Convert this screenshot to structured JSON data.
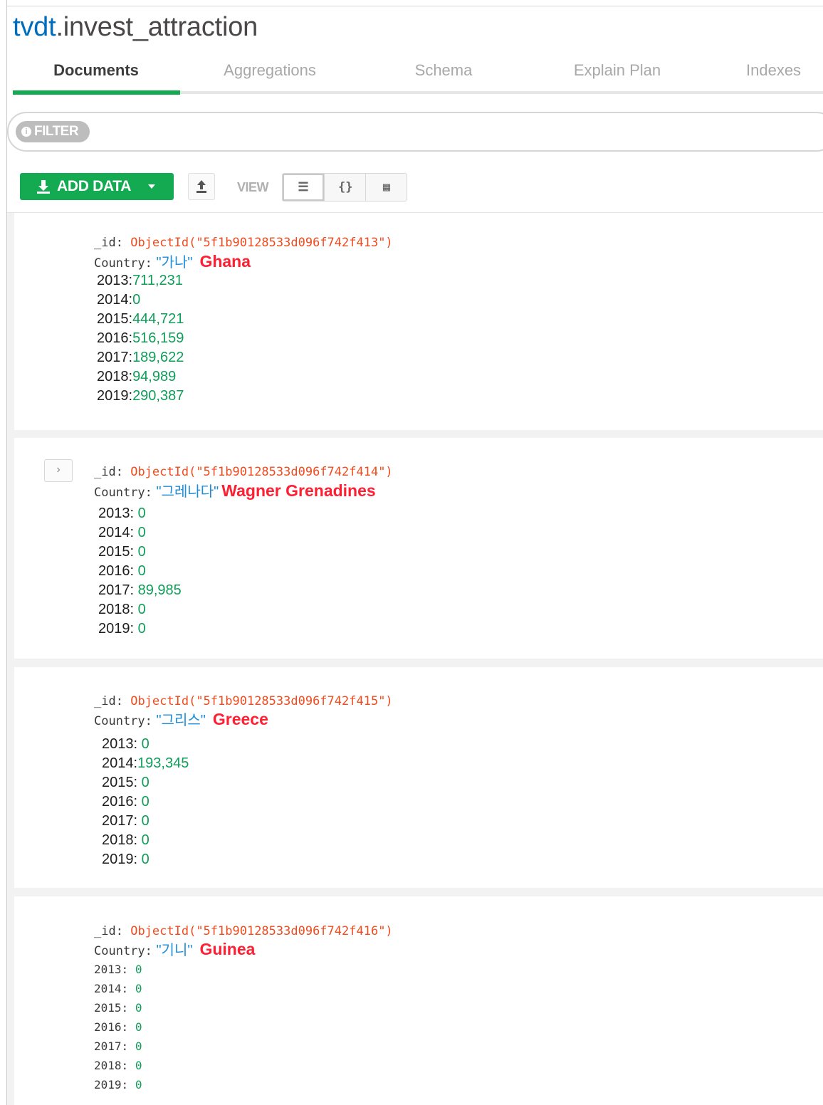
{
  "header": {
    "db": "tvdt",
    "collection": ".invest_attraction"
  },
  "tabs": [
    {
      "label": "Documents",
      "active": true
    },
    {
      "label": "Aggregations",
      "active": false
    },
    {
      "label": "Schema",
      "active": false
    },
    {
      "label": "Explain Plan",
      "active": false
    },
    {
      "label": "Indexes",
      "active": false
    }
  ],
  "filter": {
    "label": "FILTER",
    "icon": "info-icon"
  },
  "toolbar": {
    "add_data_label": "ADD DATA",
    "view_label": "VIEW",
    "views": [
      "list-view-icon",
      "json-view-icon",
      "table-view-icon"
    ],
    "active_view": "list"
  },
  "colors": {
    "accent": "#13aa52",
    "db": "#006cbc",
    "oid": "#f04b1e",
    "string": "#1e8ed8",
    "number": "#0f9d58",
    "note": "#ff1e32"
  },
  "documents": [
    {
      "id_key": "_id:",
      "id_value": "ObjectId(\"5f1b90128533d096f742f413\")",
      "country_key": "Country:",
      "country_value": "\"가나\"",
      "annotation": "Ghana",
      "years": [
        {
          "key": "2013:",
          "value": "711,231"
        },
        {
          "key": "2014:",
          "value": "0"
        },
        {
          "key": "2015:",
          "value": "444,721"
        },
        {
          "key": "2016:",
          "value": "516,159"
        },
        {
          "key": "2017:",
          "value": "189,622"
        },
        {
          "key": "2018:",
          "value": "94,989"
        },
        {
          "key": "2019:",
          "value": "290,387"
        }
      ]
    },
    {
      "id_key": "_id:",
      "id_value": "ObjectId(\"5f1b90128533d096f742f414\")",
      "country_key": "Country:",
      "country_value": "\"그레나다\"",
      "annotation": "Wagner Grenadines",
      "years": [
        {
          "key": "2013:",
          "value": "0"
        },
        {
          "key": "2014:",
          "value": "0"
        },
        {
          "key": "2015:",
          "value": "0"
        },
        {
          "key": "2016:",
          "value": "0"
        },
        {
          "key": "2017:",
          "value": "89,985"
        },
        {
          "key": "2018:",
          "value": "0"
        },
        {
          "key": "2019:",
          "value": "0"
        }
      ]
    },
    {
      "id_key": "_id:",
      "id_value": "ObjectId(\"5f1b90128533d096f742f415\")",
      "country_key": "Country:",
      "country_value": "\"그리스\"",
      "annotation": "Greece",
      "years": [
        {
          "key": "2013:",
          "value": "0"
        },
        {
          "key": "2014:",
          "value": "193,345"
        },
        {
          "key": "2015:",
          "value": "0"
        },
        {
          "key": "2016:",
          "value": "0"
        },
        {
          "key": "2017:",
          "value": "0"
        },
        {
          "key": "2018:",
          "value": "0"
        },
        {
          "key": "2019:",
          "value": "0"
        }
      ]
    },
    {
      "id_key": "_id:",
      "id_value": "ObjectId(\"5f1b90128533d096f742f416\")",
      "country_key": "Country:",
      "country_value": "\"기니\"",
      "annotation": "Guinea",
      "years": [
        {
          "key": "2013:",
          "value": "0"
        },
        {
          "key": "2014:",
          "value": "0"
        },
        {
          "key": "2015:",
          "value": "0"
        },
        {
          "key": "2016:",
          "value": "0"
        },
        {
          "key": "2017:",
          "value": "0"
        },
        {
          "key": "2018:",
          "value": "0"
        },
        {
          "key": "2019:",
          "value": "0"
        }
      ]
    }
  ]
}
